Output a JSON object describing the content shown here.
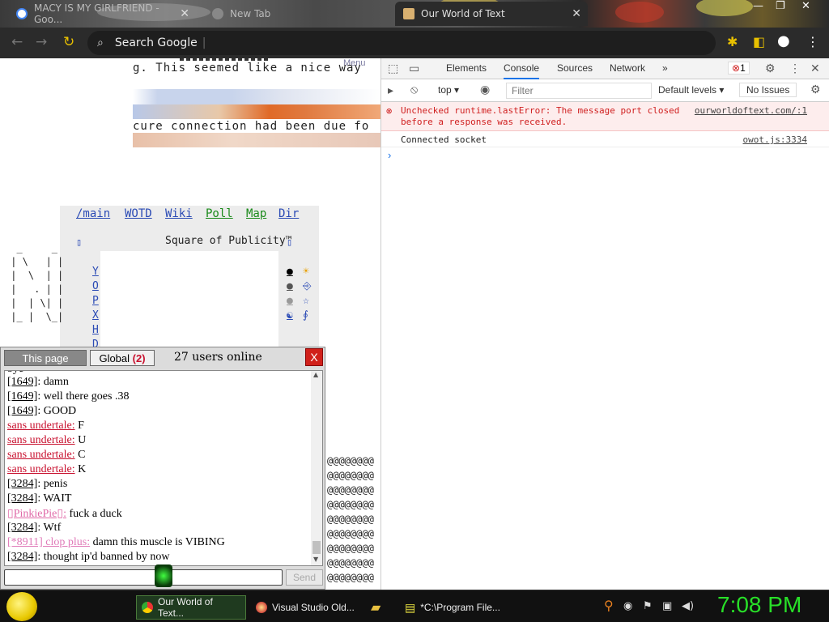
{
  "browser": {
    "tabs": [
      {
        "title": "MACY IS MY GIRLFRIEND - Goo...",
        "active": false
      },
      {
        "title": "New Tab",
        "active": false
      },
      {
        "title": "Our World of Text",
        "active": true
      }
    ],
    "omnibox_text": "Search Google",
    "accent": "#2b2b2b"
  },
  "page": {
    "line1": "g. This seemed like a nice way",
    "line2": "cure connection had been due fo",
    "menu_label": "Menu",
    "nav_links": [
      "/main",
      "WOTD",
      "Wiki",
      "Poll",
      "Map",
      "Dir"
    ],
    "square_title": "Square of Publicity™",
    "left_glyph": "▯",
    "right_glyph": "▯",
    "vertical_links": [
      "Y",
      "O",
      "P",
      "X",
      "H",
      "D"
    ],
    "right_icons": [
      "●",
      "●",
      "●",
      "☯"
    ],
    "far_right_icons": [
      "☀",
      "⎆",
      "☆",
      "∮"
    ],
    "ascii_art": "  _     _\n | \\   | |\n |  \\  | |\n |   . | |\n |  | \\| |\n |_ |  \\_|",
    "at_rows": "@@@@@@@@"
  },
  "chat": {
    "tab_this_page": "This page",
    "tab_global": "Global",
    "global_count": "(2)",
    "users_online": "27 users online",
    "close_label": "X",
    "partial_top": "bye",
    "messages": [
      {
        "nick": "[1649]",
        "sep": ":",
        "text": " damn",
        "color": "#000"
      },
      {
        "nick": "[1649]",
        "sep": ":",
        "text": " well there goes .38",
        "color": "#000"
      },
      {
        "nick": "[1649]",
        "sep": ":",
        "text": " GOOD",
        "color": "#000"
      },
      {
        "nick": "sans undertale:",
        "sep": "",
        "text": " F",
        "color": "#c8102e"
      },
      {
        "nick": "sans undertale:",
        "sep": "",
        "text": " U",
        "color": "#c8102e"
      },
      {
        "nick": "sans undertale:",
        "sep": "",
        "text": " C",
        "color": "#c8102e"
      },
      {
        "nick": "sans undertale:",
        "sep": "",
        "text": " K",
        "color": "#c8102e"
      },
      {
        "nick": "[3284]",
        "sep": ":",
        "text": " penis",
        "color": "#000"
      },
      {
        "nick": "[3284]",
        "sep": ":",
        "text": " WAIT",
        "color": "#000"
      },
      {
        "nick": "▯PinkiePie▯:",
        "sep": "",
        "text": " fuck a duck",
        "color": "#e06aa8"
      },
      {
        "nick": "[3284]",
        "sep": ":",
        "text": " Wtf",
        "color": "#000"
      },
      {
        "nick": "[*8911] clop plus:",
        "sep": "",
        "text": " damn this muscle is VIBING",
        "color": "#e07ab8"
      },
      {
        "nick": "[3284]",
        "sep": ":",
        "text": " thought ip'd banned by now",
        "color": "#000"
      }
    ],
    "send_label": "Send",
    "input_value": ""
  },
  "devtools": {
    "tabs": [
      "Elements",
      "Console",
      "Sources",
      "Network"
    ],
    "active_tab": "Console",
    "more": "»",
    "error_count": "1",
    "context": "top",
    "filter_placeholder": "Filter",
    "levels": "Default levels",
    "issues": "No Issues",
    "error_line1": "Unchecked runtime.lastError: The message port closed",
    "error_line2": "before a response was received.",
    "error_source": "ourworldoftext.com/:1",
    "log_text": "Connected socket",
    "log_source": "owot.js:3334",
    "prompt": "›"
  },
  "taskbar": {
    "items": [
      {
        "label": "Our World of Text..."
      },
      {
        "label": "Visual Studio Old..."
      },
      {
        "label": ""
      },
      {
        "label": "*C:\\Program File..."
      }
    ],
    "clock": "7:08 PM"
  }
}
